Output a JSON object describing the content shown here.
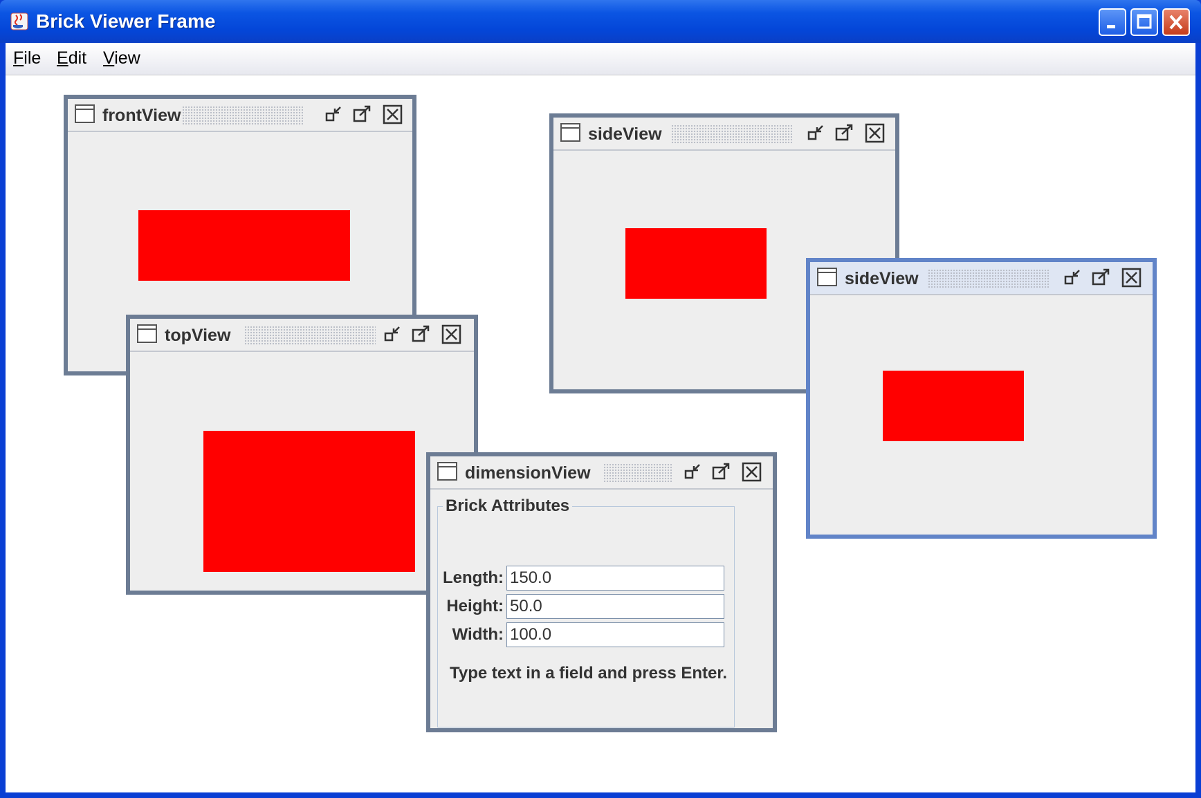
{
  "window": {
    "title": "Brick Viewer Frame",
    "controls": [
      "minimize-icon",
      "maximize-icon",
      "close-icon"
    ]
  },
  "menubar": {
    "items": [
      {
        "label": "File",
        "mnemonic": "F",
        "rest": "ile"
      },
      {
        "label": "Edit",
        "mnemonic": "E",
        "rest": "dit"
      },
      {
        "label": "View",
        "mnemonic": "V",
        "rest": "iew"
      }
    ]
  },
  "frames": {
    "front": {
      "title": "frontView"
    },
    "top": {
      "title": "topView"
    },
    "side1": {
      "title": "sideView"
    },
    "side2": {
      "title": "sideView"
    },
    "dimension": {
      "title": "dimensionView",
      "group_title": "Brick Attributes",
      "fields": {
        "length": {
          "label": "Length:",
          "value": "150.0"
        },
        "height": {
          "label": "Height:",
          "value": "50.0"
        },
        "width": {
          "label": "Width:",
          "value": "100.0"
        }
      },
      "hint": "Type text in a field and press Enter."
    }
  },
  "colors": {
    "brick": "#ff0000",
    "frame_border": "#6c7c94",
    "active_frame_border": "#6184c8",
    "titlebar": "#0446d8"
  }
}
